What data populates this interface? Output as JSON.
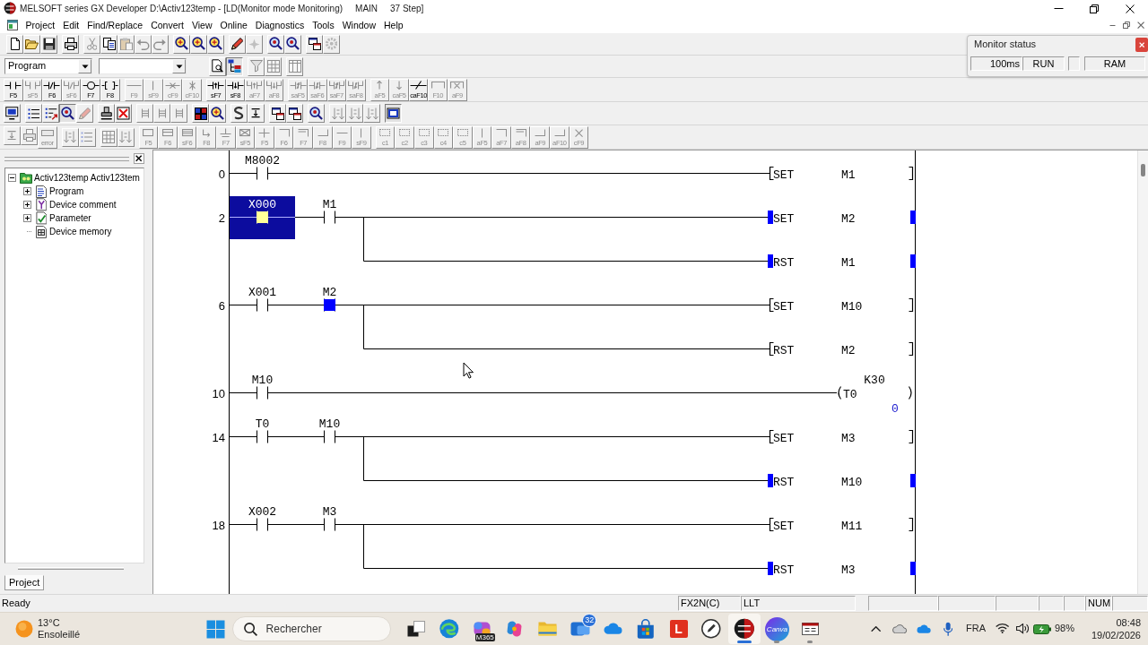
{
  "window": {
    "title": "MELSOFT series GX Developer D:\\Activ123temp - [LD(Monitor mode Monitoring)",
    "program": "MAIN",
    "steps": "37 Step]"
  },
  "menu": [
    "Project",
    "Edit",
    "Find/Replace",
    "Convert",
    "View",
    "Online",
    "Diagnostics",
    "Tools",
    "Window",
    "Help"
  ],
  "toolbars": [
    {
      "groups": [
        [
          {
            "kind": "new",
            "disabled": false
          },
          {
            "kind": "open",
            "disabled": false
          },
          {
            "kind": "save",
            "disabled": false
          }
        ],
        [
          {
            "kind": "print",
            "disabled": false
          }
        ],
        [
          {
            "kind": "cut",
            "disabled": true
          },
          {
            "kind": "copy",
            "disabled": false
          },
          {
            "kind": "paste",
            "disabled": true
          },
          {
            "kind": "undo",
            "disabled": true
          },
          {
            "kind": "redo",
            "disabled": true
          }
        ],
        [
          {
            "kind": "monitor",
            "disabled": false
          },
          {
            "kind": "monitor",
            "disabled": false
          },
          {
            "kind": "monitor",
            "disabled": false
          }
        ],
        [
          {
            "kind": "pencil",
            "disabled": false
          },
          {
            "kind": "sparkle",
            "disabled": true
          }
        ],
        [
          {
            "kind": "zoom",
            "disabled": false
          },
          {
            "kind": "zoom",
            "disabled": false
          }
        ],
        [
          {
            "kind": "windows",
            "disabled": false
          },
          {
            "kind": "gear",
            "disabled": true
          }
        ]
      ]
    },
    {
      "selects": [
        {
          "value": "Program",
          "disabled": false
        },
        {
          "disabled": false
        }
      ],
      "groups": [
        [
          {
            "kind": "doc-search",
            "disabled": false,
            "pressed": false
          },
          {
            "kind": "tree",
            "disabled": false,
            "pressed": true
          }
        ],
        [
          {
            "kind": "funnel",
            "disabled": true,
            "pressed": false
          },
          {
            "kind": "grid",
            "disabled": true,
            "pressed": false
          }
        ],
        [
          {
            "kind": "columns",
            "disabled": true,
            "pressed": false
          }
        ]
      ]
    },
    {
      "groups": [
        [
          {
            "kind": "contact",
            "label": "F5",
            "disabled": false
          },
          {
            "kind": "contact-branch",
            "label": "sF5",
            "disabled": true
          },
          {
            "kind": "nc",
            "label": "F6",
            "disabled": false
          },
          {
            "kind": "nc-branch",
            "label": "sF6",
            "disabled": true
          },
          {
            "kind": "coil",
            "label": "F7",
            "disabled": false
          },
          {
            "kind": "instruction",
            "label": "F8",
            "disabled": false
          }
        ],
        [
          {
            "kind": "hline",
            "label": "F9",
            "disabled": true
          },
          {
            "kind": "vline",
            "label": "sF9",
            "disabled": true
          },
          {
            "kind": "hline-x",
            "label": "cF9",
            "disabled": true
          },
          {
            "kind": "vline-x",
            "label": "cF10",
            "disabled": true
          }
        ],
        [
          {
            "kind": "rise",
            "label": "sF7",
            "disabled": false
          },
          {
            "kind": "fall",
            "label": "sF8",
            "disabled": false
          },
          {
            "kind": "rise-branch",
            "label": "aF7",
            "disabled": true
          },
          {
            "kind": "fall-branch",
            "label": "aF8",
            "disabled": true
          }
        ],
        [
          {
            "kind": "rise-nc",
            "label": "saF5",
            "disabled": true
          },
          {
            "kind": "fall-nc",
            "label": "saF6",
            "disabled": true
          },
          {
            "kind": "rise-nc-branch",
            "label": "saF7",
            "disabled": true
          },
          {
            "kind": "fall-nc-branch",
            "label": "saF8",
            "disabled": true
          }
        ],
        [
          {
            "kind": "arrow-up",
            "label": "aF5",
            "disabled": true
          },
          {
            "kind": "arrow-down",
            "label": "caF5",
            "disabled": true
          },
          {
            "kind": "invert",
            "label": "caF10",
            "disabled": false
          },
          {
            "kind": "draw-line",
            "label": "F10",
            "disabled": true
          },
          {
            "kind": "erase-line",
            "label": "aF9",
            "disabled": true
          }
        ]
      ]
    },
    {
      "groups": [
        [
          {
            "kind": "screen",
            "disabled": false,
            "pressed": false
          }
        ],
        [
          {
            "kind": "list",
            "disabled": false,
            "pressed": false
          },
          {
            "kind": "list-arrow",
            "disabled": false,
            "pressed": false
          },
          {
            "kind": "zoom",
            "disabled": false,
            "pressed": true
          },
          {
            "kind": "pencil",
            "disabled": true,
            "pressed": false
          }
        ],
        [
          {
            "kind": "stamp",
            "disabled": false,
            "pressed": false
          },
          {
            "kind": "cross",
            "disabled": false,
            "pressed": false
          }
        ],
        [
          {
            "kind": "ladder",
            "disabled": true,
            "pressed": false
          },
          {
            "kind": "ladder",
            "disabled": true,
            "pressed": false
          },
          {
            "kind": "ladder",
            "disabled": true,
            "pressed": false
          }
        ],
        [
          {
            "kind": "grid-color",
            "disabled": false,
            "pressed": false
          },
          {
            "kind": "monitor",
            "disabled": false,
            "pressed": false
          }
        ],
        [
          {
            "kind": "s-curve",
            "disabled": false,
            "pressed": false
          },
          {
            "kind": "arrow-bar",
            "disabled": false,
            "pressed": false
          }
        ],
        [
          {
            "kind": "windows",
            "disabled": false,
            "pressed": false
          },
          {
            "kind": "windows",
            "disabled": false,
            "pressed": false
          }
        ],
        [
          {
            "kind": "zoom",
            "disabled": false,
            "pressed": false
          }
        ],
        [
          {
            "kind": "sort",
            "disabled": true,
            "pressed": false
          },
          {
            "kind": "sort",
            "disabled": true,
            "pressed": false
          },
          {
            "kind": "sort",
            "disabled": true,
            "pressed": false
          }
        ],
        [
          {
            "kind": "frame",
            "disabled": false,
            "pressed": true
          }
        ]
      ]
    },
    {
      "groups": [
        [
          {
            "kind": "arrow-bar",
            "disabled": true
          },
          {
            "kind": "print",
            "disabled": true
          },
          {
            "kind": "error",
            "label": "error",
            "disabled": true
          }
        ],
        [
          {
            "kind": "sort",
            "disabled": true
          },
          {
            "kind": "list",
            "disabled": true
          }
        ],
        [
          {
            "kind": "grid",
            "disabled": true
          },
          {
            "kind": "sort",
            "disabled": true
          }
        ],
        [
          {
            "kind": "sfc-step",
            "label": "F5",
            "disabled": true
          },
          {
            "kind": "sfc-step-line",
            "label": "F6",
            "disabled": true
          },
          {
            "kind": "sfc-step-lines",
            "label": "sF6",
            "disabled": true
          },
          {
            "kind": "sfc-jump",
            "label": "F8",
            "disabled": true
          },
          {
            "kind": "sfc-transition",
            "label": "F7",
            "disabled": true
          },
          {
            "kind": "sfc-crossed",
            "label": "sF5",
            "disabled": true
          },
          {
            "kind": "sfc-plus",
            "label": "F5",
            "disabled": true
          },
          {
            "kind": "sfc-corner",
            "label": "F6",
            "disabled": true
          },
          {
            "kind": "sfc-corner2",
            "label": "F7",
            "disabled": true
          },
          {
            "kind": "sfc-corner-bottom",
            "label": "F8",
            "disabled": true
          },
          {
            "kind": "sfc-hline",
            "label": "F9",
            "disabled": true
          },
          {
            "kind": "sfc-vline",
            "label": "sF9",
            "disabled": true
          }
        ],
        [
          {
            "kind": "sfc-dashed",
            "label": "c1",
            "disabled": true
          },
          {
            "kind": "sfc-dashed",
            "label": "c2",
            "disabled": true
          },
          {
            "kind": "sfc-dashed",
            "label": "c3",
            "disabled": true
          },
          {
            "kind": "sfc-dashed",
            "label": "c4",
            "disabled": true
          },
          {
            "kind": "sfc-dashed",
            "label": "c5",
            "disabled": true
          },
          {
            "kind": "sfc-vline",
            "label": "aF5",
            "disabled": true
          },
          {
            "kind": "sfc-corner",
            "label": "aF7",
            "disabled": true
          },
          {
            "kind": "sfc-corner2",
            "label": "aF8",
            "disabled": true
          },
          {
            "kind": "sfc-corner-bottom",
            "label": "aF9",
            "disabled": true
          },
          {
            "kind": "sfc-corner-bottom",
            "label": "aF10",
            "disabled": true
          },
          {
            "kind": "sfc-x",
            "label": "cF9",
            "disabled": true
          }
        ]
      ]
    }
  ],
  "monitor_status": {
    "title": "Monitor status",
    "scan_time": "100ms",
    "cpu_state": "RUN",
    "memory": "RAM"
  },
  "project_tree": {
    "items": [
      {
        "label": "Activ123temp Activ123tem",
        "kind": "project",
        "expandable": true,
        "expanded": true,
        "children": [
          {
            "label": "Program",
            "kind": "program",
            "expandable": true,
            "expanded": false
          },
          {
            "label": "Device comment",
            "kind": "comment",
            "expandable": true,
            "expanded": false
          },
          {
            "label": "Parameter",
            "kind": "parameter",
            "expandable": true,
            "expanded": false
          },
          {
            "label": "Device memory",
            "kind": "memory",
            "expandable": false
          }
        ]
      }
    ],
    "tabs": [
      {
        "label": "Project",
        "selected": true
      }
    ]
  },
  "ladder": {
    "rungs": [
      {
        "step": "0",
        "contacts": [
          {
            "device": "M8002",
            "on": false,
            "selected": false
          }
        ],
        "outputs": [
          {
            "kind": "instruction",
            "instruction": "SET",
            "device": "M1",
            "on": false
          }
        ]
      },
      {
        "step": "2",
        "contacts": [
          {
            "device": "X000",
            "on": true,
            "selected": true
          },
          {
            "device": "M1",
            "on": false,
            "selected": false
          }
        ],
        "outputs": [
          {
            "kind": "instruction",
            "instruction": "SET",
            "device": "M2",
            "on": true
          },
          {
            "kind": "instruction",
            "instruction": "RST",
            "device": "M1",
            "on": true
          }
        ]
      },
      {
        "step": "6",
        "contacts": [
          {
            "device": "X001",
            "on": false,
            "selected": false
          },
          {
            "device": "M2",
            "on": true,
            "selected": false
          }
        ],
        "outputs": [
          {
            "kind": "instruction",
            "instruction": "SET",
            "device": "M10",
            "on": false
          },
          {
            "kind": "instruction",
            "instruction": "RST",
            "device": "M2",
            "on": false
          }
        ]
      },
      {
        "step": "10",
        "contacts": [
          {
            "device": "M10",
            "on": false,
            "selected": false
          }
        ],
        "outputs": [
          {
            "kind": "coil",
            "device": "T0",
            "constant": "K30",
            "value": "0",
            "on": false
          }
        ]
      },
      {
        "step": "14",
        "contacts": [
          {
            "device": "T0",
            "on": false,
            "selected": false
          },
          {
            "device": "M10",
            "on": false,
            "selected": false
          }
        ],
        "outputs": [
          {
            "kind": "instruction",
            "instruction": "SET",
            "device": "M3",
            "on": false
          },
          {
            "kind": "instruction",
            "instruction": "RST",
            "device": "M10",
            "on": true
          }
        ]
      },
      {
        "step": "18",
        "contacts": [
          {
            "device": "X002",
            "on": false,
            "selected": false
          },
          {
            "device": "M3",
            "on": false,
            "selected": false
          }
        ],
        "outputs": [
          {
            "kind": "instruction",
            "instruction": "SET",
            "device": "M11",
            "on": false
          },
          {
            "kind": "instruction",
            "instruction": "RST",
            "device": "M3",
            "on": true
          }
        ]
      }
    ]
  },
  "status_bar": {
    "message": "Ready",
    "plc_type": "FX2N(C)",
    "simulator": "LLT",
    "keyboard": "NUM"
  },
  "taskbar": {
    "weather": {
      "temperature": "13°C",
      "condition": "Ensoleillé"
    },
    "search": {
      "placeholder": "Rechercher"
    },
    "apps": [
      {
        "kind": "squares",
        "running": false,
        "active": false
      },
      {
        "kind": "swirl",
        "running": false,
        "active": false
      },
      {
        "kind": "colorful-tile",
        "caption": "M365",
        "running": false,
        "active": false
      },
      {
        "kind": "knot",
        "running": false,
        "active": false
      },
      {
        "kind": "folder",
        "running": false,
        "active": false
      },
      {
        "kind": "tiles",
        "badge": "32",
        "running": false,
        "active": false
      },
      {
        "kind": "cloud",
        "running": false,
        "active": false
      },
      {
        "kind": "bag",
        "running": false,
        "active": false
      },
      {
        "kind": "letter",
        "label": "L",
        "running": false,
        "active": false
      },
      {
        "kind": "pencil-circle",
        "running": false,
        "active": false
      },
      {
        "kind": "striped-circle",
        "running": true,
        "active": true
      },
      {
        "kind": "round-logo",
        "label": "Canva",
        "running": true,
        "active": false
      },
      {
        "kind": "small-window",
        "running": true,
        "active": false
      }
    ],
    "tray": {
      "language": "FRA",
      "battery": "98%",
      "time": "08:48",
      "date": "19/02/2026"
    }
  }
}
